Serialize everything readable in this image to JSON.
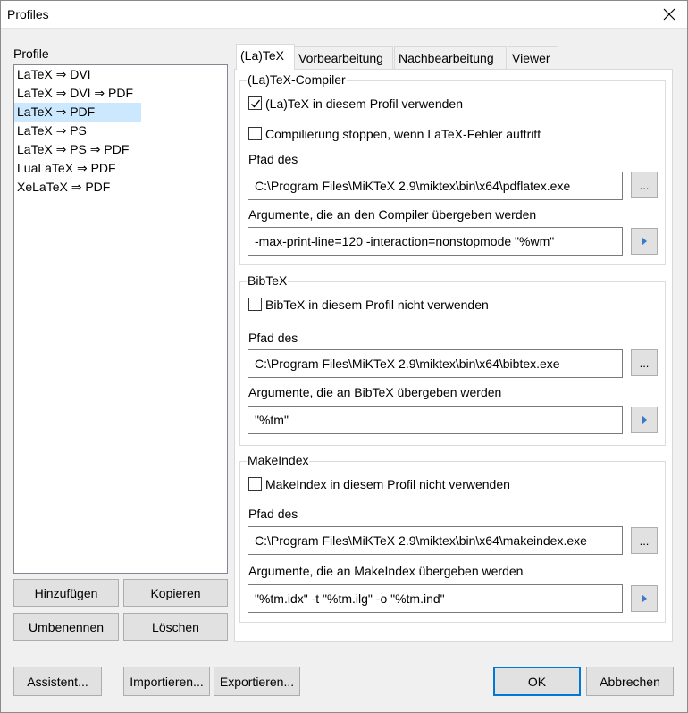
{
  "window": {
    "title": "Profiles"
  },
  "profiles": {
    "label": "Profile",
    "items": [
      "LaTeX ⇒ DVI",
      "LaTeX ⇒ DVI ⇒ PDF",
      "LaTeX ⇒ PDF",
      "LaTeX ⇒ PS",
      "LaTeX ⇒ PS ⇒ PDF",
      "LuaLaTeX ⇒ PDF",
      "XeLaTeX ⇒ PDF"
    ],
    "selected_index": 2,
    "buttons": {
      "add": "Hinzufügen",
      "copy": "Kopieren",
      "rename": "Umbenennen",
      "delete": "Löschen"
    }
  },
  "tabs": [
    "(La)TeX",
    "Vorbearbeitung",
    "Nachbearbeitung",
    "Viewer"
  ],
  "compiler": {
    "group_title": "(La)TeX-Compiler",
    "use_checkbox": {
      "label": "(La)TeX in diesem Profil verwenden",
      "checked": true
    },
    "stop_checkbox": {
      "label": "Compilierung stoppen, wenn LaTeX-Fehler auftritt",
      "checked": false
    },
    "path_label": "Pfad des",
    "path_value": "C:\\Program Files\\MiKTeX 2.9\\miktex\\bin\\x64\\pdflatex.exe",
    "args_label": "Argumente, die an den Compiler übergeben werden",
    "args_value": "-max-print-line=120 -interaction=nonstopmode \"%wm\""
  },
  "bibtex": {
    "group_title": "BibTeX",
    "disable_checkbox": {
      "label": "BibTeX in diesem Profil nicht verwenden",
      "checked": false
    },
    "path_label": "Pfad des",
    "path_value": "C:\\Program Files\\MiKTeX 2.9\\miktex\\bin\\x64\\bibtex.exe",
    "args_label": "Argumente, die an BibTeX übergeben werden",
    "args_value": "\"%tm\""
  },
  "makeindex": {
    "group_title": "MakeIndex",
    "disable_checkbox": {
      "label": "MakeIndex in diesem Profil nicht verwenden",
      "checked": false
    },
    "path_label": "Pfad des",
    "path_value": "C:\\Program Files\\MiKTeX 2.9\\miktex\\bin\\x64\\makeindex.exe",
    "args_label": "Argumente, die an MakeIndex übergeben werden",
    "args_value": "\"%tm.idx\" -t \"%tm.ilg\" -o \"%tm.ind\""
  },
  "browse_label": "...",
  "footer": {
    "wizard": "Assistent...",
    "import": "Importieren...",
    "export": "Exportieren...",
    "ok": "OK",
    "cancel": "Abbrechen"
  },
  "colors": {
    "accent": "#0078d7",
    "selection": "#cce8ff",
    "arrow": "#3c78c8"
  }
}
